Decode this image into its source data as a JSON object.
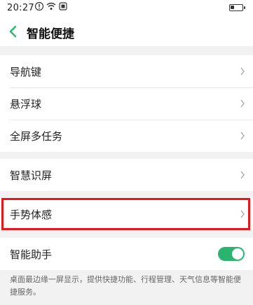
{
  "status_bar": {
    "time": "20:27",
    "icons": [
      "warning-icon",
      "wifi-icon",
      "notification-icon"
    ],
    "battery_level": 0.3
  },
  "header": {
    "title": "智能便捷",
    "back_icon": "chevron-left-icon"
  },
  "groups": [
    {
      "items": [
        {
          "label": "导航键"
        },
        {
          "label": "悬浮球"
        },
        {
          "label": "全屏多任务"
        }
      ]
    },
    {
      "items": [
        {
          "label": "智慧识屏"
        }
      ]
    },
    {
      "items": [
        {
          "label": "手势体感"
        }
      ]
    },
    {
      "items": [
        {
          "label": "智能助手",
          "toggle": true
        }
      ]
    }
  ],
  "footer": {
    "description": "桌面最边缘一屏显示，提供快捷功能、行程管理、天气信息等智能便捷服务。"
  },
  "colors": {
    "accent_toggle": "#2bb46e",
    "highlight_border": "#e5161c"
  }
}
